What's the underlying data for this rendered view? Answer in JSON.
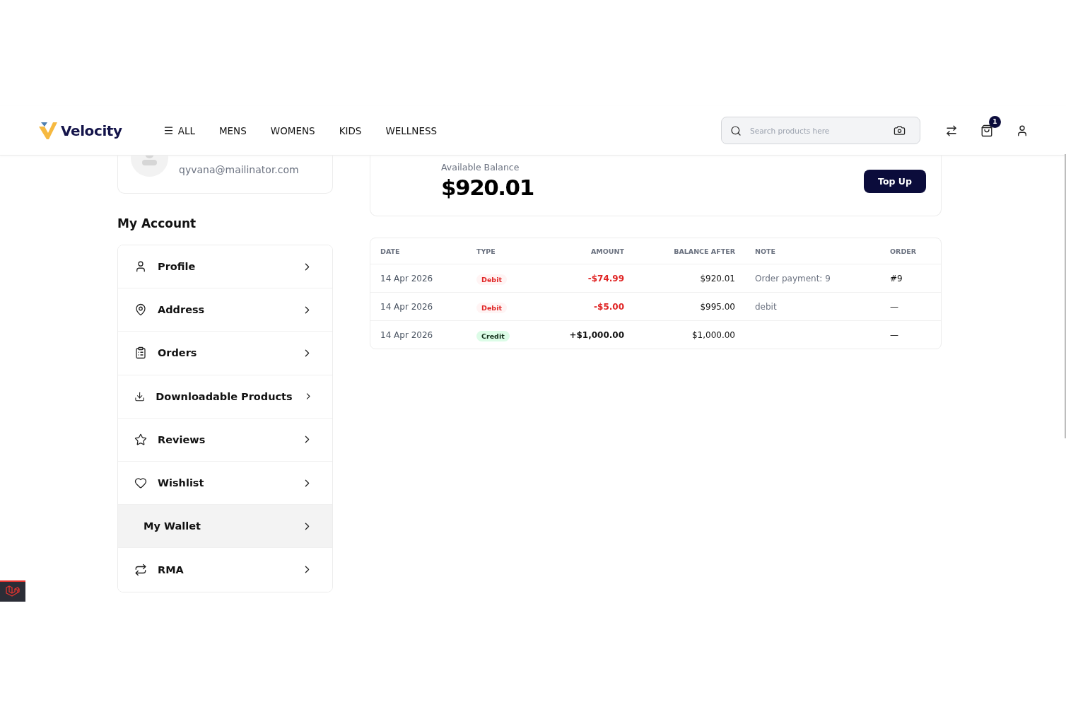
{
  "header": {
    "logo": "Velocity",
    "nav": [
      {
        "label": "ALL",
        "kind": "menu"
      },
      {
        "label": "MENS",
        "kind": "link"
      },
      {
        "label": "WOMENS",
        "kind": "link"
      },
      {
        "label": "KIDS",
        "kind": "link"
      },
      {
        "label": "WELLNESS",
        "kind": "link"
      }
    ],
    "search": {
      "placeholder": "Search products here"
    },
    "cart_count": "1"
  },
  "profile": {
    "email": "qyvana@mailinator.com"
  },
  "sidebar": {
    "title": "My Account",
    "items": [
      {
        "label": "Profile",
        "selected": false
      },
      {
        "label": "Address",
        "selected": false
      },
      {
        "label": "Orders",
        "selected": false
      },
      {
        "label": "Downloadable Products",
        "selected": false
      },
      {
        "label": "Reviews",
        "selected": false
      },
      {
        "label": "Wishlist",
        "selected": false
      },
      {
        "label": "My Wallet",
        "selected": true
      },
      {
        "label": "RMA",
        "selected": false
      }
    ]
  },
  "wallet": {
    "balance_label": "Available Balance",
    "balance": "$920.01",
    "top_up": "Top Up"
  },
  "transactions": {
    "columns": [
      "DATE",
      "TYPE",
      "AMOUNT",
      "BALANCE AFTER",
      "NOTE",
      "ORDER"
    ],
    "rows": [
      {
        "date": "14 Apr 2026",
        "type": "Debit",
        "kind": "debit",
        "amount": "-$74.99",
        "balance_after": "$920.01",
        "note": "Order payment: 9",
        "order": "#9"
      },
      {
        "date": "14 Apr 2026",
        "type": "Debit",
        "kind": "debit",
        "amount": "-$5.00",
        "balance_after": "$995.00",
        "note": "debit",
        "order": "—"
      },
      {
        "date": "14 Apr 2026",
        "type": "Credit",
        "kind": "credit",
        "amount": "+$1,000.00",
        "balance_after": "$1,000.00",
        "order": "—"
      }
    ]
  }
}
